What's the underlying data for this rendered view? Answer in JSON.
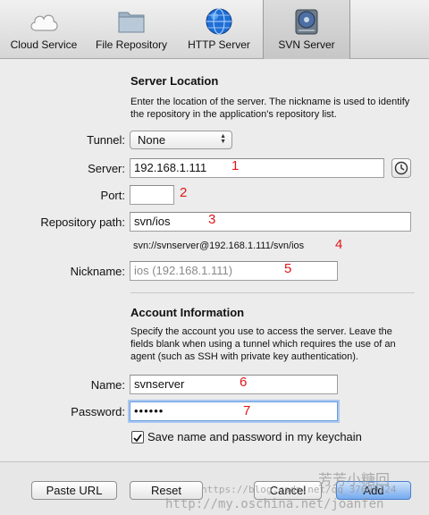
{
  "toolbar": {
    "tabs": [
      {
        "label": "Cloud Service",
        "icon": "cloud-icon"
      },
      {
        "label": "File Repository",
        "icon": "folder-icon"
      },
      {
        "label": "HTTP Server",
        "icon": "globe-icon"
      },
      {
        "label": "SVN Server",
        "icon": "hard-drive-icon",
        "selected": true
      }
    ]
  },
  "server_location": {
    "title": "Server Location",
    "description": "Enter the location of the server. The nickname is used to identify the repository in the application's repository list.",
    "tunnel_label": "Tunnel:",
    "tunnel_value": "None",
    "server_label": "Server:",
    "server_value": "192.168.1.111",
    "port_label": "Port:",
    "port_value": "",
    "repo_path_label": "Repository path:",
    "repo_path_value": "svn/ios",
    "url_preview": "svn://svnserver@192.168.1.111/svn/ios",
    "nickname_label": "Nickname:",
    "nickname_placeholder": "ios (192.168.1.111)"
  },
  "account": {
    "title": "Account Information",
    "description": "Specify the account you use to access the server. Leave the fields blank when using a tunnel which requires the use of an agent (such as SSH with private key authentication).",
    "name_label": "Name:",
    "name_value": "svnserver",
    "password_label": "Password:",
    "password_value": "••••••",
    "keychain_label": "Save name and password in my keychain",
    "keychain_checked": true
  },
  "annotations": [
    "1",
    "2",
    "3",
    "4",
    "5",
    "6",
    "7"
  ],
  "buttons": {
    "paste_url": "Paste URL",
    "reset": "Reset",
    "cancel": "Cancel",
    "add": "Add"
  },
  "watermark": {
    "line1": "https://blog.csdn.net/qq_37690324",
    "line2": "http://my.oschina.net/joanfen",
    "logo": "芳芳小糖回"
  },
  "colors": {
    "annotation": "#e0161a",
    "focus_ring": "#a9c8f1",
    "default_button": "#74a9ef"
  }
}
